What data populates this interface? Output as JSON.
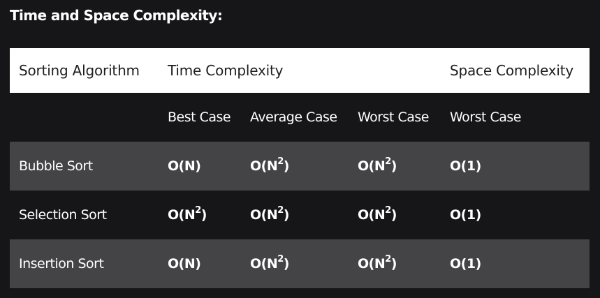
{
  "page_title": "Time and Space Complexity:",
  "table": {
    "header": {
      "algorithm": "Sorting Algorithm",
      "time": "Time Complexity",
      "space": "Space Complexity"
    },
    "subheader": {
      "best": "Best Case",
      "average": "Average Case",
      "worst": "Worst Case",
      "space_worst": "Worst Case"
    },
    "rows": [
      {
        "name": "Bubble Sort",
        "best": {
          "base": "O(N",
          "exp": "",
          "close": ")"
        },
        "average": {
          "base": "O(N",
          "exp": "2",
          "close": ")"
        },
        "worst": {
          "base": "O(N",
          "exp": "2",
          "close": ")"
        },
        "space": {
          "base": "O(1",
          "exp": "",
          "close": ")"
        }
      },
      {
        "name": "Selection Sort",
        "best": {
          "base": "O(N",
          "exp": "2",
          "close": ")"
        },
        "average": {
          "base": "O(N",
          "exp": "2",
          "close": ")"
        },
        "worst": {
          "base": "O(N",
          "exp": "2",
          "close": ")"
        },
        "space": {
          "base": "O(1",
          "exp": "",
          "close": ")"
        }
      },
      {
        "name": "Insertion Sort",
        "best": {
          "base": "O(N",
          "exp": "",
          "close": ")"
        },
        "average": {
          "base": "O(N",
          "exp": "2",
          "close": ")"
        },
        "worst": {
          "base": "O(N",
          "exp": "2",
          "close": ")"
        },
        "space": {
          "base": "O(1",
          "exp": "",
          "close": ")"
        }
      }
    ]
  },
  "colors": {
    "page_background": "#161619",
    "header_background": "#ffffff",
    "header_text": "#1e1e1e",
    "shaded_row": "#444446",
    "text": "#ffffff"
  }
}
